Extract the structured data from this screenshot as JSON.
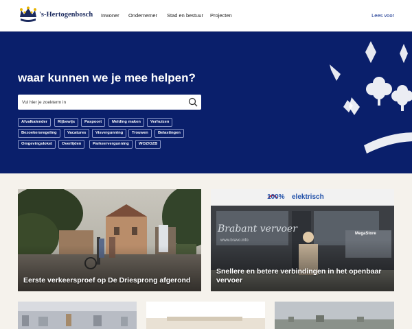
{
  "header": {
    "logo_text": "'s-Hertogenbosch",
    "nav": [
      "Inwoner",
      "Ondernemer",
      "Stad en bestuur",
      "Projecten"
    ],
    "read_aloud": "Lees voor"
  },
  "hero": {
    "heading": "waar kunnen we je mee helpen?",
    "search_placeholder": "Vul hier je zoekterm in",
    "tags": [
      [
        "Afvalkalender",
        "Rijbewijs",
        "Paspoort",
        "Melding maken",
        "Verhuizen"
      ],
      [
        "Bezoekersregeling",
        "Vacatures",
        "Visvergunning",
        "Trouwen",
        "Belastingen"
      ],
      [
        "Omgevingsloket",
        "Overlijden",
        "Parkeervergunning",
        "WOZ/OZB"
      ]
    ]
  },
  "cards": [
    {
      "title": "Eerste verkeersproef op De Driesprong afgerond"
    },
    {
      "title": "Snellere en betere verbindingen in het openbaar vervoer",
      "image_text": [
        "100%",
        "elektrisch",
        "Brabant vervoer",
        "www.bravo.info",
        "MegaStore"
      ]
    },
    {
      "title": ""
    },
    {
      "title": ""
    },
    {
      "title": ""
    }
  ],
  "colors": {
    "hero_bg": "#0a1f6b",
    "page_bg": "#f5f2ec",
    "brand": "#1b2a5e",
    "link": "#0a2a8a"
  }
}
